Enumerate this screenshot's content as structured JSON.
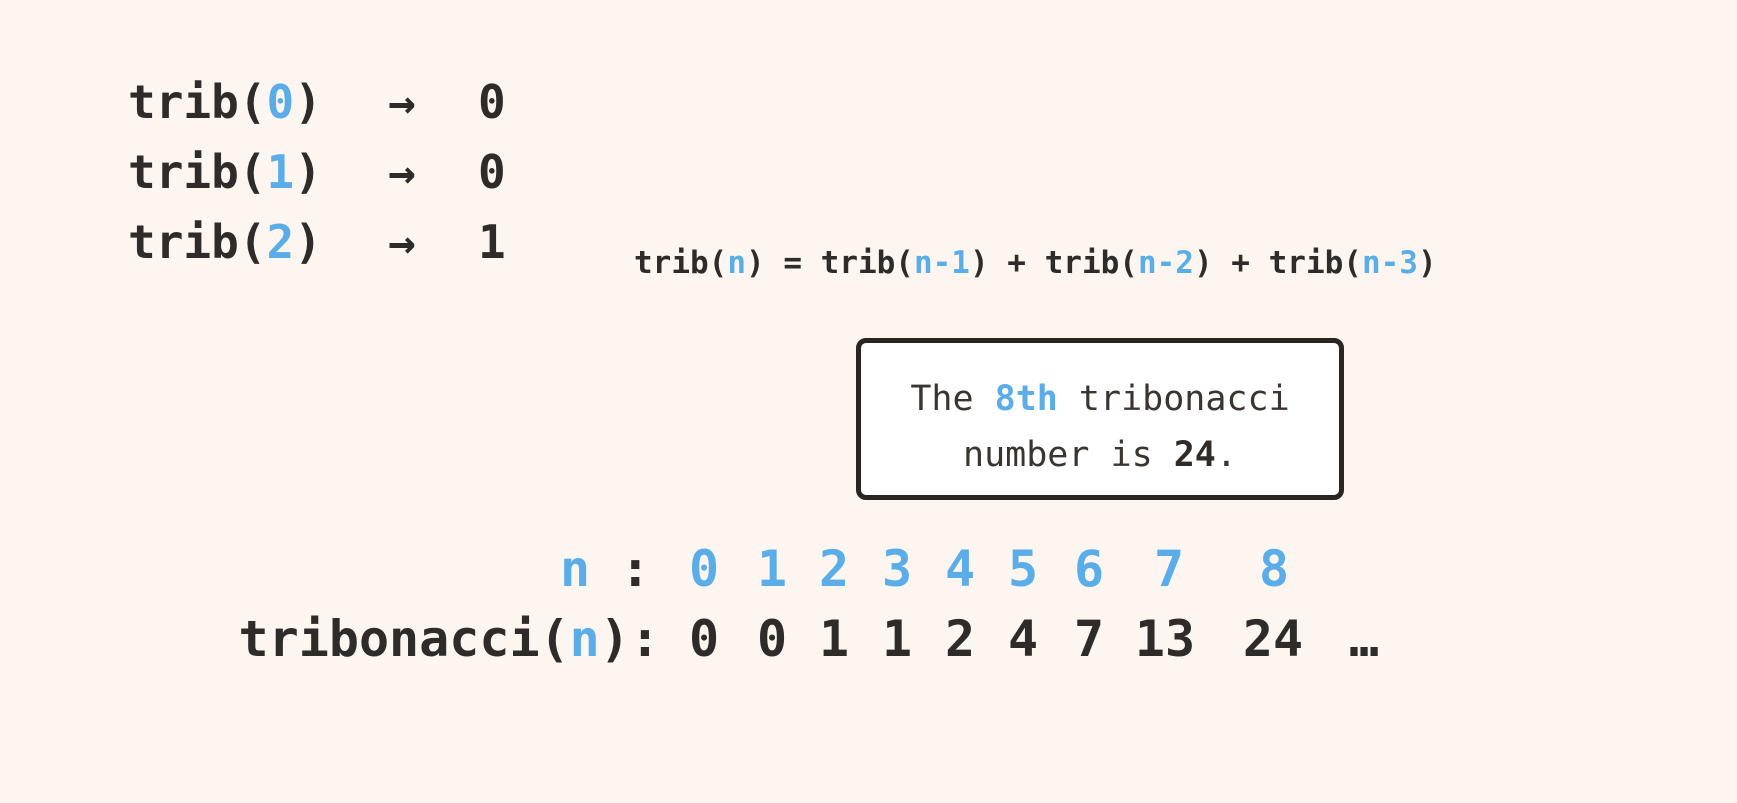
{
  "base_cases": [
    {
      "fn": "trib(",
      "arg": "0",
      "close": ")",
      "arrow": "→",
      "result": "0"
    },
    {
      "fn": "trib(",
      "arg": "1",
      "close": ")",
      "arrow": "→",
      "result": "0"
    },
    {
      "fn": "trib(",
      "arg": "2",
      "close": ")",
      "arrow": "→",
      "result": "1"
    }
  ],
  "formula": {
    "lhs_fn": "trib(",
    "lhs_arg": "n",
    "lhs_close": ") = ",
    "t1_fn": "trib(",
    "t1_arg": "n-1",
    "t1_close": ") + ",
    "t2_fn": "trib(",
    "t2_arg": "n-2",
    "t2_close": ") + ",
    "t3_fn": "trib(",
    "t3_arg": "n-3",
    "t3_close": ")"
  },
  "callout": {
    "pre": "The ",
    "highlight": "8th",
    "mid": " tribonacci",
    "line2_pre": "number is ",
    "value": "24",
    "end": "."
  },
  "sequence": {
    "n_label": "n",
    "n_sep": " :",
    "value_label_fn": "tribonacci(",
    "value_label_arg": "n",
    "value_label_close": "):",
    "n_values": [
      "0",
      "1",
      "2",
      "3",
      "4",
      "5",
      "6",
      "7",
      "8"
    ],
    "trib_values": [
      "0",
      "0",
      "1",
      "1",
      "2",
      "4",
      "7",
      "13",
      "24"
    ],
    "ellipsis": "…"
  },
  "colors": {
    "background": "#fdf6f0",
    "text": "#2f2b28",
    "accent": "#5aade8",
    "callout_border": "#2b2522"
  }
}
